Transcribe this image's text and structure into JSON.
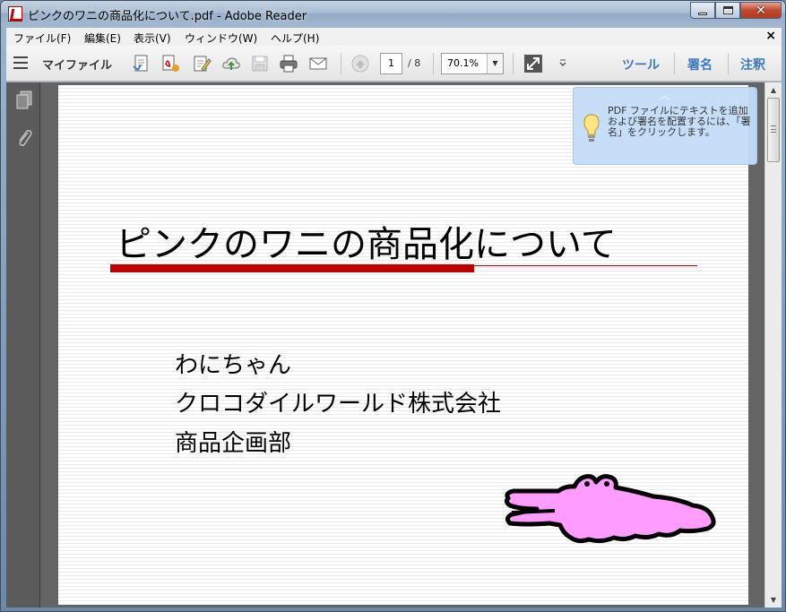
{
  "window": {
    "title": "ピンクのワニの商品化について.pdf - Adobe Reader"
  },
  "menu": {
    "items": [
      "ファイル(F)",
      "編集(E)",
      "表示(V)",
      "ウィンドウ(W)",
      "ヘルプ(H)"
    ],
    "close": "×"
  },
  "toolbar": {
    "myfile": "マイファイル",
    "page_current": "1",
    "page_total": "/ 8",
    "zoom": "70.1%",
    "tools": "ツール",
    "sign": "署名",
    "comment": "注釈"
  },
  "tooltip": {
    "text": "PDF ファイルにテキストを追加および署名を配置するには、「署名」をクリックします。"
  },
  "document": {
    "title": "ピンクのワニの商品化について",
    "lines": [
      "わにちゃん",
      "クロコダイルワールド株式会社",
      "商品企画部"
    ],
    "accent_color": "#c00000",
    "crocodile_color": "#ff9cff"
  }
}
